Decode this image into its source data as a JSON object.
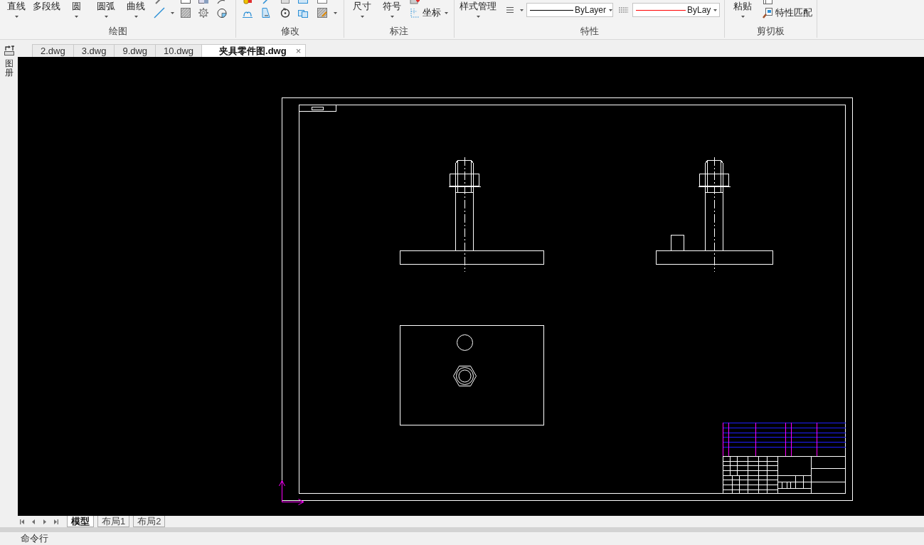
{
  "ribbon": {
    "groups": [
      {
        "kind": "draw",
        "label": "绘图",
        "buttons": [
          {
            "label": "直线",
            "menu": true
          },
          {
            "label": "多段线",
            "menu": false
          },
          {
            "label": "圆",
            "menu": true
          },
          {
            "label": "圆弧",
            "menu": true
          },
          {
            "label": "曲线",
            "menu": true
          }
        ]
      },
      {
        "kind": "modify",
        "label": "修改"
      },
      {
        "kind": "annotate",
        "label": "标注",
        "buttons": [
          {
            "label": "尺寸",
            "menu": true
          },
          {
            "label": "符号",
            "menu": true
          }
        ],
        "tools": [
          {
            "label": "坐标",
            "menu": true
          }
        ]
      },
      {
        "kind": "properties",
        "label": "特性",
        "buttons": [
          {
            "label": "样式管理",
            "menu": true
          }
        ],
        "linetype": {
          "value": "ByLayer"
        },
        "color": {
          "value": "ByLay"
        }
      },
      {
        "kind": "clipboard",
        "label": "剪切板",
        "buttons": [
          {
            "label": "粘贴",
            "menu": true
          }
        ],
        "tools": [
          {
            "label": "特性匹配",
            "menu": false
          }
        ]
      }
    ]
  },
  "side_panel": {
    "label": "图册"
  },
  "document_tabs": [
    {
      "label": "2.dwg",
      "selected": false
    },
    {
      "label": "3.dwg",
      "selected": false
    },
    {
      "label": "9.dwg",
      "selected": false
    },
    {
      "label": "10.dwg",
      "selected": false
    },
    {
      "label": "夹具零件图.dwg",
      "selected": true,
      "close": "×"
    }
  ],
  "layout_tabs": [
    {
      "label": "模型",
      "selected": true
    },
    {
      "label": "布局1",
      "selected": false
    },
    {
      "label": "布局2",
      "selected": false
    }
  ],
  "command_line": {
    "label": "命令行"
  }
}
